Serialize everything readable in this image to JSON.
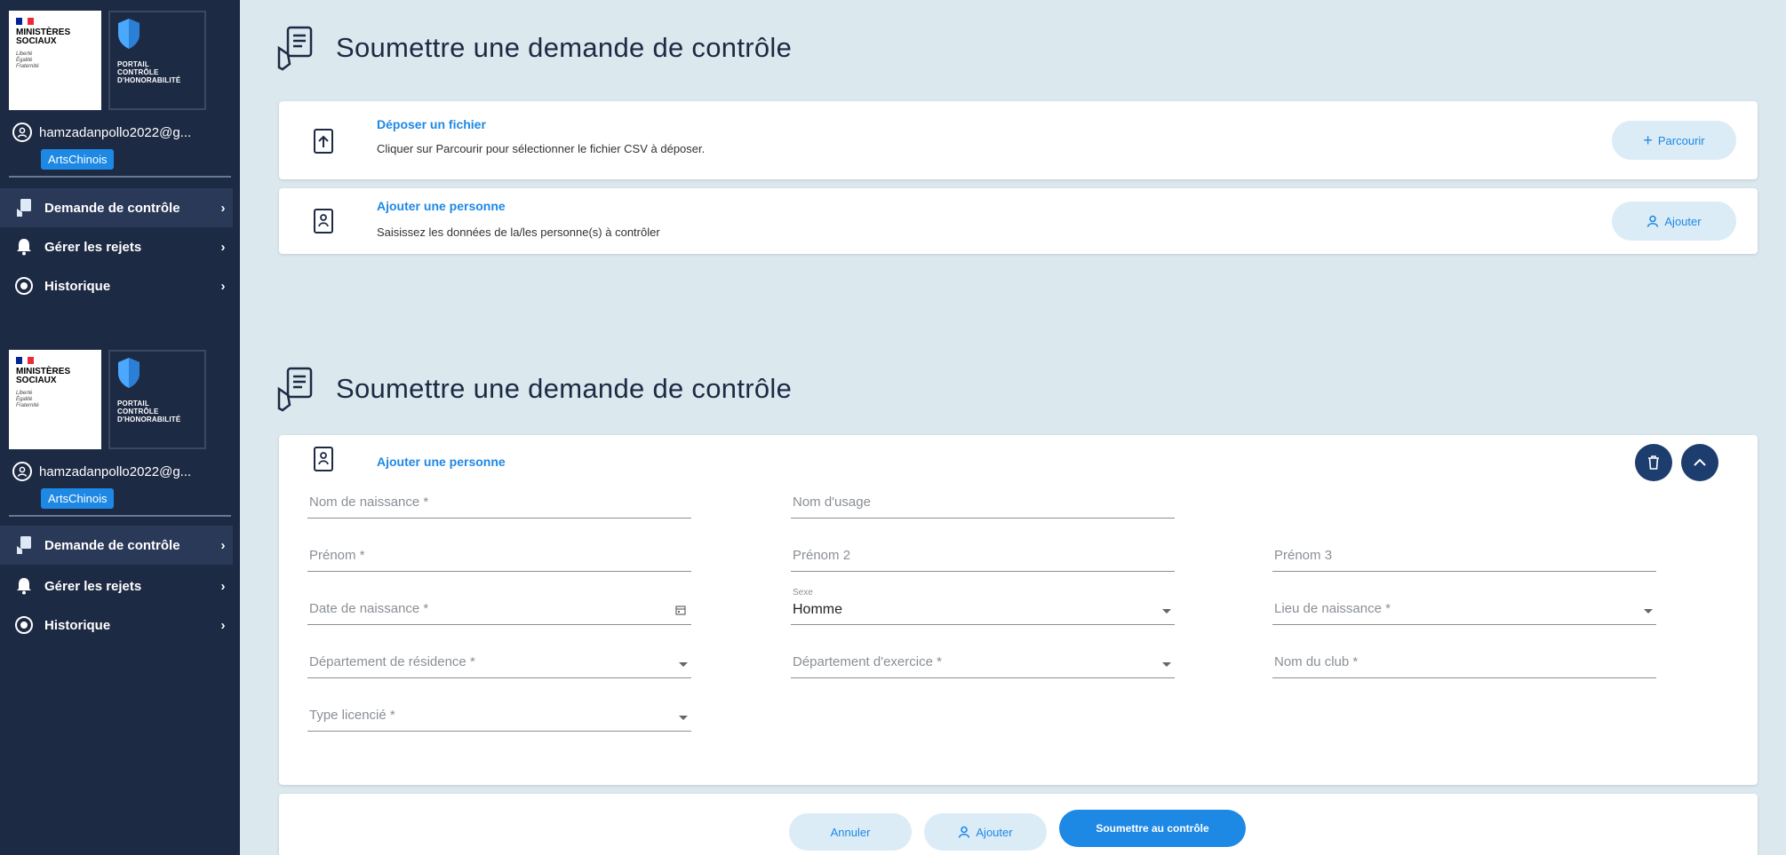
{
  "brand": {
    "ministry": [
      "MINISTÈRES",
      "SOCIAUX"
    ],
    "motto": [
      "Liberté",
      "Égalité",
      "Fraternité"
    ],
    "portal": [
      "PORTAIL",
      "CONTRÔLE",
      "D'HONORABILITÉ"
    ]
  },
  "user": {
    "email": "hamzadanpollo2022@g...",
    "org": "ArtsChinois"
  },
  "nav": [
    {
      "label": "Demande de contrôle",
      "icon": "document-hand-icon"
    },
    {
      "label": "Gérer les rejets",
      "icon": "bell-icon"
    },
    {
      "label": "Historique",
      "icon": "history-icon"
    }
  ],
  "page": {
    "title": "Soumettre une demande de contrôle"
  },
  "upload_card": {
    "title": "Déposer un fichier",
    "subtitle": "Cliquer sur Parcourir pour sélectionner le fichier CSV à déposer.",
    "button": "Parcourir"
  },
  "add_card": {
    "title": "Ajouter une personne",
    "subtitle": "Saisissez les données de la/les personne(s) à contrôler",
    "button": "Ajouter"
  },
  "form": {
    "title": "Ajouter une personne",
    "fields": {
      "nom_naissance": "Nom de naissance *",
      "nom_usage": "Nom d'usage",
      "prenom": "Prénom *",
      "prenom2": "Prénom 2",
      "prenom3": "Prénom 3",
      "date_naissance": "Date de naissance *",
      "sexe_label": "Sexe",
      "sexe_value": "Homme",
      "lieu_naissance": "Lieu de naissance *",
      "dept_residence": "Département de résidence *",
      "dept_exercice": "Département d'exercice *",
      "nom_club": "Nom du club *",
      "type_licencie": "Type licencié *"
    }
  },
  "actions": {
    "cancel": "Annuler",
    "add": "Ajouter",
    "submit": "Soumettre au contrôle"
  },
  "colors": {
    "sidebar": "#1d2a44",
    "accent": "#1e88e5",
    "background": "#dbe8ee"
  }
}
